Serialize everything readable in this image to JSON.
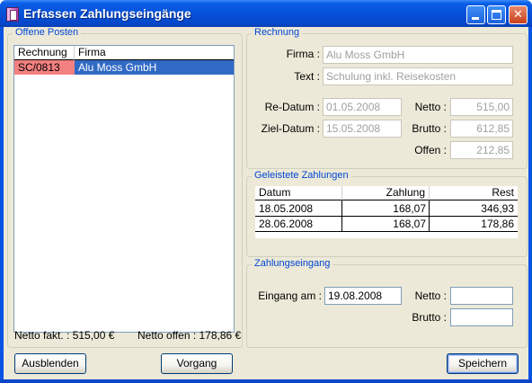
{
  "window": {
    "title": "Erfassen Zahlungseingänge",
    "accent": "#0a54e3"
  },
  "offene_posten": {
    "title": "Offene Posten",
    "columns": [
      "Rechnung",
      "Firma"
    ],
    "rows": [
      {
        "rechnung": "SC/0813",
        "firma": "Alu Moss GmbH",
        "rechnung_bg": "#f28080",
        "firma_bg": "#316ac5"
      }
    ],
    "netto_fakt": "Netto fakt. : 515,00 €",
    "netto_offen": "Netto offen : 178,86 €"
  },
  "rechnung": {
    "title": "Rechnung",
    "firma_label": "Firma :",
    "firma_value": "Alu Moss GmbH",
    "text_label": "Text :",
    "text_value": "Schulung inkl. Reisekosten",
    "re_datum_label": "Re-Datum :",
    "re_datum_value": "01.05.2008",
    "ziel_datum_label": "Ziel-Datum :",
    "ziel_datum_value": "15.05.2008",
    "netto_label": "Netto :",
    "netto_value": "515,00",
    "brutto_label": "Brutto :",
    "brutto_value": "612,85",
    "offen_label": "Offen :",
    "offen_value": "212,85"
  },
  "zahlungen": {
    "title": "Geleistete Zahlungen",
    "columns": [
      "Datum",
      "Zahlung",
      "Rest"
    ],
    "rows": [
      {
        "datum": "18.05.2008",
        "zahlung": "168,07",
        "rest": "346,93"
      },
      {
        "datum": "28.06.2008",
        "zahlung": "168,07",
        "rest": "178,86"
      }
    ]
  },
  "eingang": {
    "title": "Zahlungseingang",
    "eingang_label": "Eingang am :",
    "eingang_value": "19.08.2008",
    "netto_label": "Netto :",
    "netto_value": "",
    "brutto_label": "Brutto :",
    "brutto_value": ""
  },
  "buttons": {
    "ausblenden": "Ausblenden",
    "vorgang": "Vorgang",
    "speichern": "Speichern"
  }
}
